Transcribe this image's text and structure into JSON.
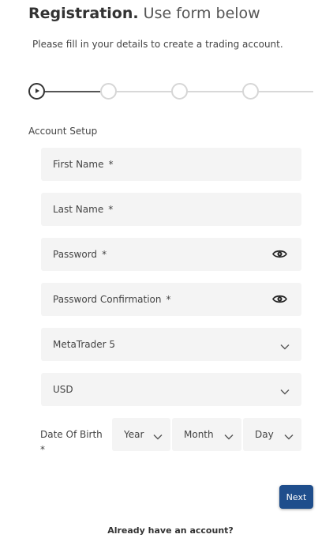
{
  "header": {
    "title_bold": "Registration.",
    "title_light": "Use form below",
    "subtitle": "Please fill in your details to create a trading account."
  },
  "stepper": {
    "total_steps": 4,
    "current_step": 1
  },
  "section": {
    "label": "Account Setup"
  },
  "form": {
    "required_mark": "*",
    "first_name": "First Name",
    "last_name": "Last Name",
    "password": "Password",
    "password_confirmation": "Password Confirmation",
    "platform": "MetaTrader 5",
    "currency": "USD",
    "dob": {
      "label": "Date Of Birth",
      "year": "Year",
      "month": "Month",
      "day": "Day"
    }
  },
  "actions": {
    "next": "Next",
    "login_prompt": "Already have an account?"
  },
  "icons": {
    "eye": "eye-icon",
    "chevron": "chevron-down-icon"
  },
  "colors": {
    "primary": "#1f4e8c",
    "field_bg": "#f4f4f4",
    "step_active": "#333333",
    "step_inactive": "#d6d6d6"
  }
}
